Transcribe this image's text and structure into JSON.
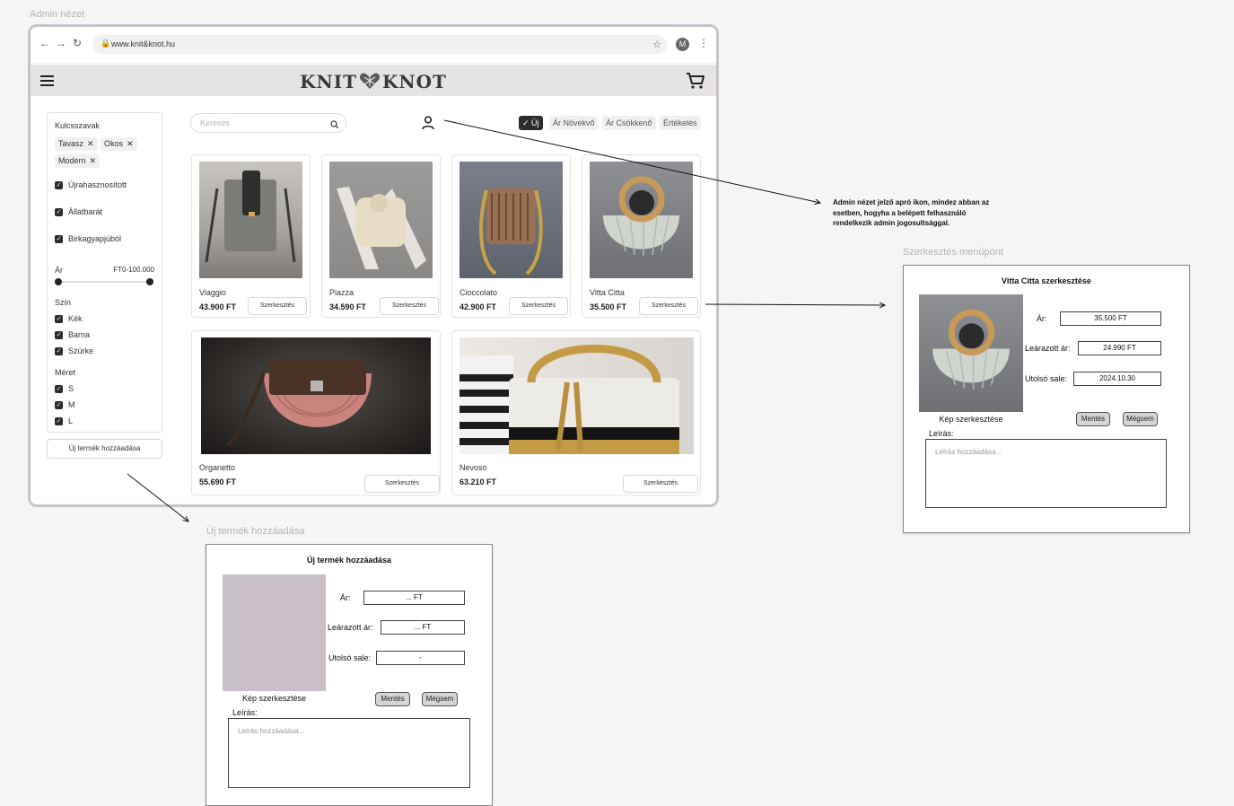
{
  "labels": {
    "admin_view": "Admin nézet",
    "edit_menu": "Szerkesztés menüpont",
    "new_product": "Új termék hozzáadása"
  },
  "browser": {
    "url": "www.knit&knot.hu",
    "avatar_letter": "M"
  },
  "header": {
    "logo_left": "KNIT",
    "logo_right": "KNOT"
  },
  "sidebar": {
    "keywords_title": "Kulcsszavak",
    "chips": [
      "Tavasz",
      "Okos",
      "Modern"
    ],
    "checks": [
      "Újrahasznosított",
      "Állatbarát",
      "Birkagyapjúból"
    ],
    "price_title": "Ár",
    "price_range": "FT0-100.000",
    "color_title": "Szín",
    "colors": [
      "Kék",
      "Barna",
      "Szürke"
    ],
    "size_title": "Méret",
    "sizes": [
      "S",
      "M",
      "L"
    ],
    "add_button": "Új termék hozzáadása"
  },
  "toolbar": {
    "search_placeholder": "Keresés",
    "sort": [
      "Új",
      "Ár Növekvő",
      "Ár Csökkenő",
      "Értékelés"
    ],
    "sort_active": 0
  },
  "products": [
    {
      "name": "Viaggio",
      "price": "43.900 FT",
      "edit": "Szerkesztés"
    },
    {
      "name": "Piazza",
      "price": "34.590 FT",
      "edit": "Szerkesztés"
    },
    {
      "name": "Cioccolato",
      "price": "42.900 FT",
      "edit": "Szerkesztés"
    },
    {
      "name": "Vitta Citta",
      "price": "35.500 FT",
      "edit": "Szerkesztés"
    },
    {
      "name": "Organetto",
      "price": "55.690 FT",
      "edit": "Szerkesztés"
    },
    {
      "name": "Nevoso",
      "price": "63.210 FT",
      "edit": "Szerkesztés"
    }
  ],
  "annotation": "Admin nézet jelző apró ikon, mindez abban az esetben, hogyha a belépett felhasználó rendelkezik admin jogosultsággal.",
  "edit_panel": {
    "title": "Vitta Citta szerkesztése",
    "price_label": "Ár:",
    "price_value": "35.500 FT",
    "discount_label": "Leárazott ár:",
    "discount_value": "24.990 FT",
    "sale_label": "Utolsó sale:",
    "sale_value": "2024.10.30",
    "image_caption": "Kép szerkesztése",
    "save": "Mentés",
    "cancel": "Mégsem",
    "desc_label": "Leírás:",
    "desc_placeholder": "Leírás hozzáadása..."
  },
  "new_panel": {
    "title": "Új termék hozzáadása",
    "price_label": "Ár:",
    "price_value": "... FT",
    "discount_label": "Leárazott ár:",
    "discount_value": "... FT",
    "sale_label": "Utolsó sale:",
    "sale_value": "-",
    "image_caption": "Kép szerkesztése",
    "save": "Mentés",
    "cancel": "Mégsem",
    "desc_label": "Leírás:",
    "desc_placeholder": "Leírás hozzáadása..."
  }
}
